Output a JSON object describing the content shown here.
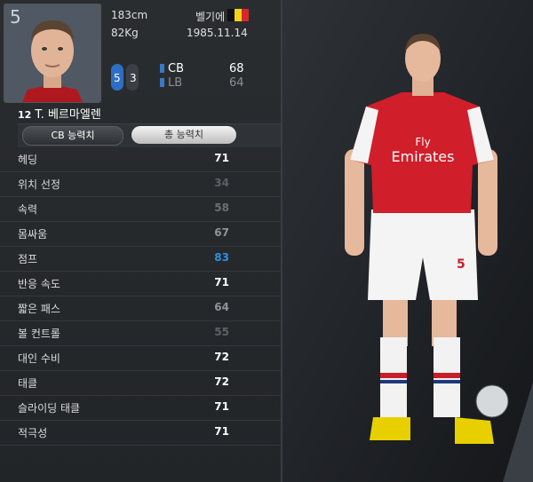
{
  "player": {
    "number": "5",
    "height": "183cm",
    "weight": "82Kg",
    "nationality": "벨기에",
    "birthdate": "1985.11.14",
    "shirt_number": "12",
    "name": "T. 베르마엘렌",
    "left_foot": "5",
    "right_foot": "3",
    "positions": [
      {
        "code": "CB",
        "rating": "68"
      },
      {
        "code": "LB",
        "rating": "64"
      }
    ]
  },
  "tabs": {
    "cb_ability": "CB 능력치",
    "total_ability": "총 능력치"
  },
  "stats": [
    {
      "label": "헤딩",
      "value": "71",
      "color": "#ffffff"
    },
    {
      "label": "위치 선정",
      "value": "34",
      "color": "#5c6166"
    },
    {
      "label": "속력",
      "value": "58",
      "color": "#6a6f74"
    },
    {
      "label": "몸싸움",
      "value": "67",
      "color": "#8f9499"
    },
    {
      "label": "점프",
      "value": "83",
      "color": "#2f8fe0"
    },
    {
      "label": "반응 속도",
      "value": "71",
      "color": "#ffffff"
    },
    {
      "label": "짧은 패스",
      "value": "64",
      "color": "#8f9499"
    },
    {
      "label": "볼 컨트롤",
      "value": "55",
      "color": "#5c6166"
    },
    {
      "label": "대인 수비",
      "value": "72",
      "color": "#ffffff"
    },
    {
      "label": "태클",
      "value": "72",
      "color": "#ffffff"
    },
    {
      "label": "슬라이딩 태클",
      "value": "71",
      "color": "#ffffff"
    },
    {
      "label": "적극성",
      "value": "71",
      "color": "#ffffff"
    }
  ],
  "kit": {
    "sponsor_line1": "Fly",
    "sponsor_line2": "Emirates",
    "shorts_number": "5"
  },
  "colors": {
    "accent_blue": "#3a78c8",
    "kit_red": "#d01e2a"
  }
}
